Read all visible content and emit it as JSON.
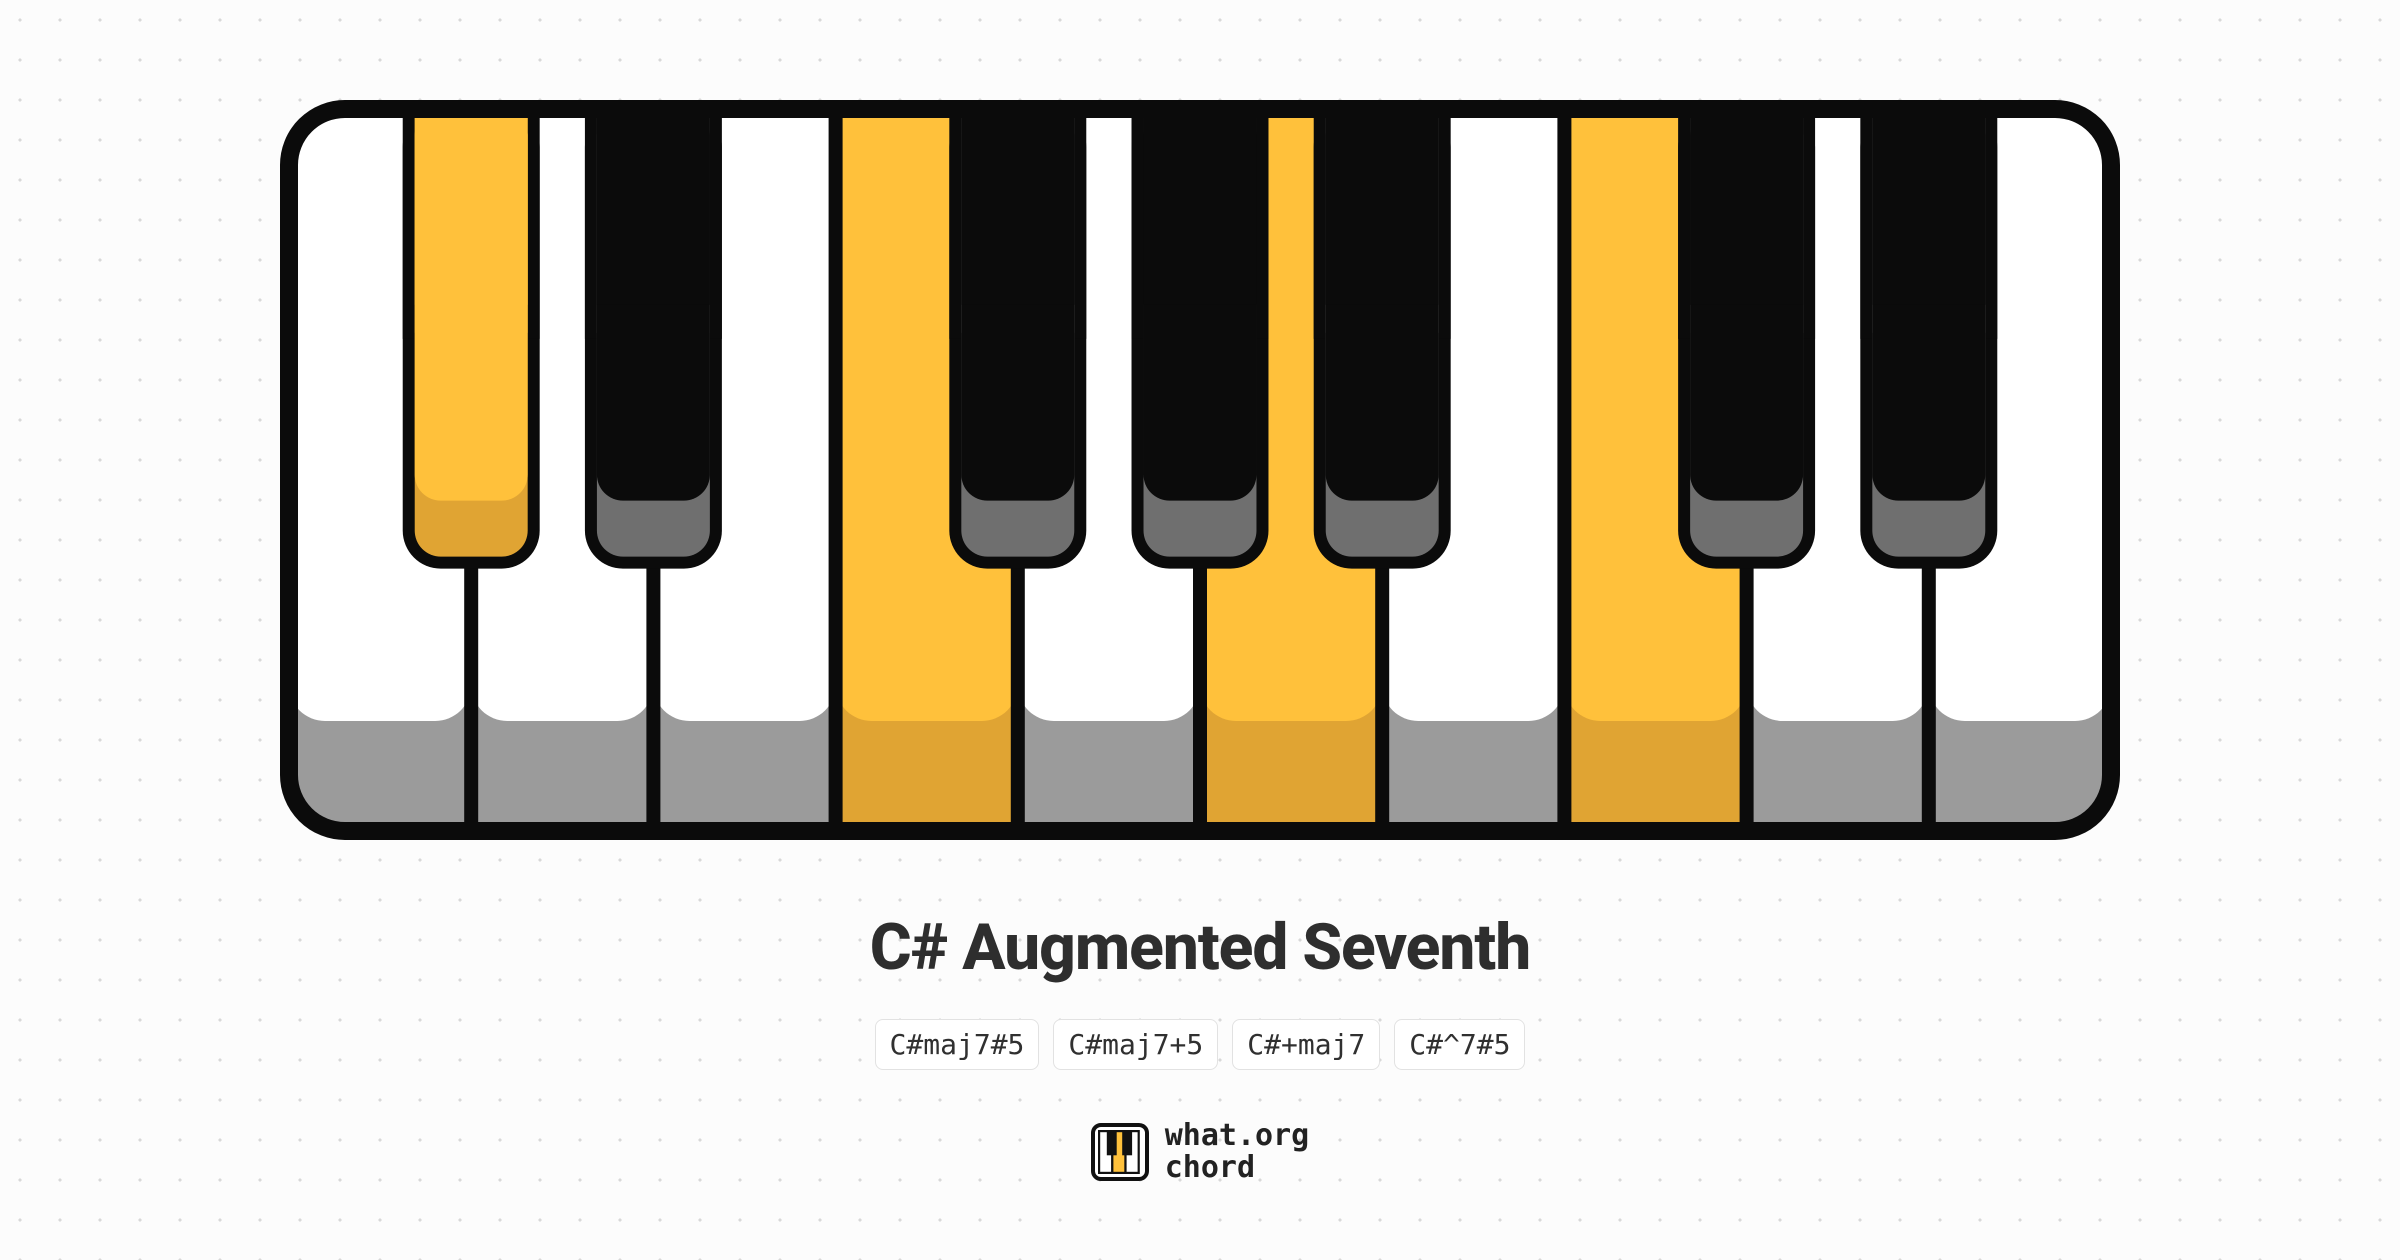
{
  "chord": {
    "title": "C# Augmented Seventh",
    "alternates": [
      "C#maj7#5",
      "C#maj7+5",
      "C#+maj7",
      "C#^7#5"
    ]
  },
  "keyboard": {
    "white_keys": [
      {
        "note": "C",
        "highlighted": false
      },
      {
        "note": "D",
        "highlighted": false
      },
      {
        "note": "E",
        "highlighted": false
      },
      {
        "note": "F",
        "highlighted": true
      },
      {
        "note": "G",
        "highlighted": false
      },
      {
        "note": "A",
        "highlighted": true
      },
      {
        "note": "B",
        "highlighted": false
      },
      {
        "note": "C2",
        "highlighted": true
      },
      {
        "note": "D2",
        "highlighted": false
      },
      {
        "note": "E2",
        "highlighted": false
      }
    ],
    "black_keys": [
      {
        "note": "C#",
        "after_white_index": 0,
        "highlighted": true
      },
      {
        "note": "D#",
        "after_white_index": 1,
        "highlighted": false
      },
      {
        "note": "F#",
        "after_white_index": 3,
        "highlighted": false
      },
      {
        "note": "G#",
        "after_white_index": 4,
        "highlighted": false
      },
      {
        "note": "A#",
        "after_white_index": 5,
        "highlighted": false
      },
      {
        "note": "C#2",
        "after_white_index": 7,
        "highlighted": false
      },
      {
        "note": "D#2",
        "after_white_index": 8,
        "highlighted": false
      }
    ]
  },
  "colors": {
    "highlight": "#ffc13b",
    "highlight_shadow": "#e0a433",
    "white_key": "#ffffff",
    "white_shadow": "#9b9b9b",
    "black_key": "#0b0b0b",
    "black_shadow": "#6f6f6f",
    "outline": "#0b0b0b"
  },
  "brand": {
    "line1": "what.org",
    "line2": "chord"
  }
}
